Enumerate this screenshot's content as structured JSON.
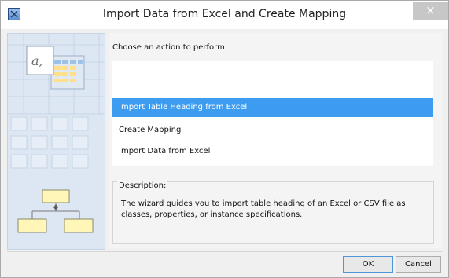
{
  "window": {
    "title": "Import Data from Excel and Create Mapping",
    "close_glyph": "×",
    "icon": "wizard-app-icon"
  },
  "wizard": {
    "prompt": "Choose an action to perform:",
    "actions": [
      {
        "label": "Import Table Heading from Excel",
        "selected": true
      },
      {
        "label": "Create Mapping",
        "selected": false
      },
      {
        "label": "Import Data from Excel",
        "selected": false
      }
    ],
    "description_label": "Description:",
    "description_text": "The wizard guides you to import table heading of an Excel or CSV file as classes, properties, or instance specifications.",
    "illustration_glyph": "a,"
  },
  "buttons": {
    "ok": "OK",
    "cancel": "Cancel"
  },
  "colors": {
    "selection": "#3d9cf0",
    "side_panel": "#dde7f3",
    "diagram_box": "#fff6b8"
  }
}
